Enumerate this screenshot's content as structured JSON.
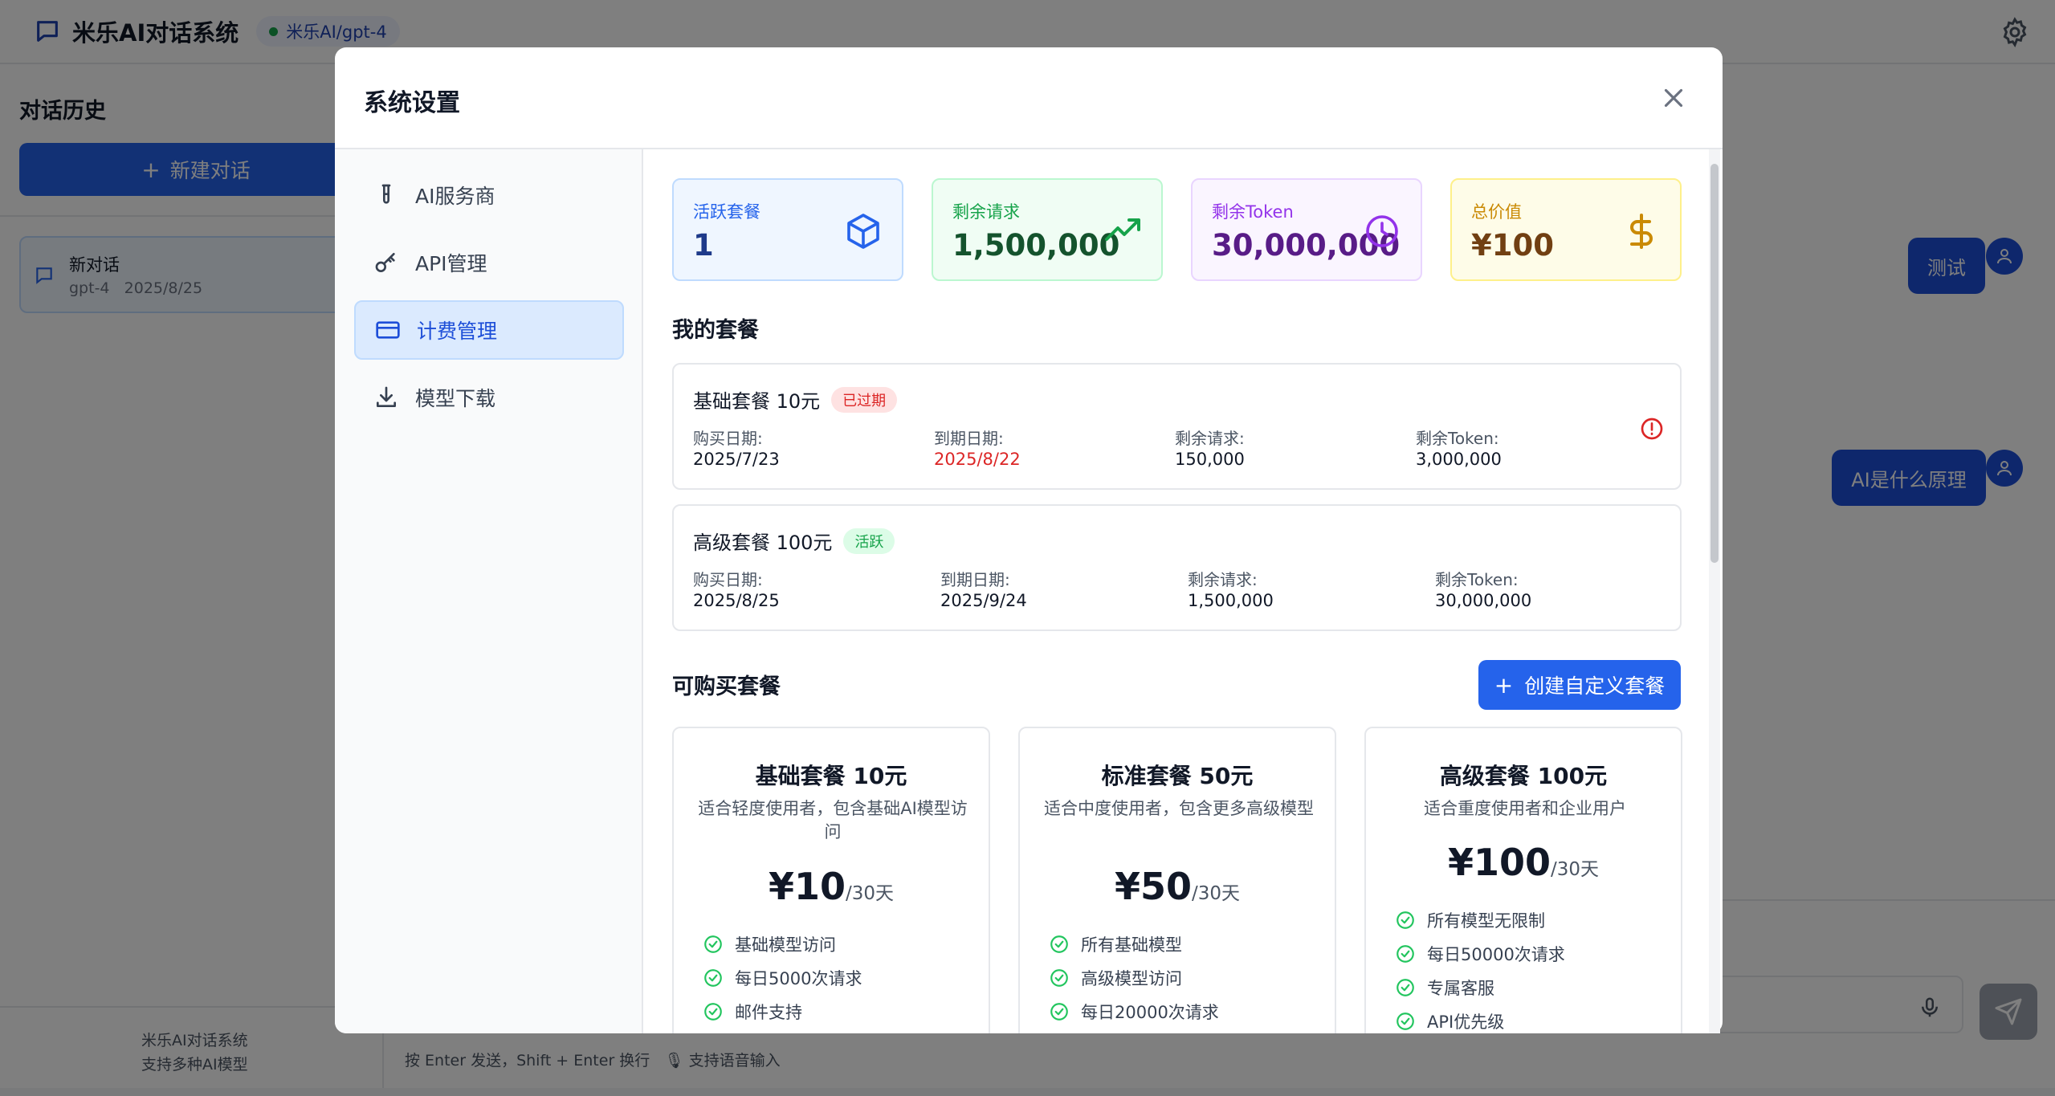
{
  "header": {
    "title": "米乐AI对话系统",
    "model": "米乐AI/gpt-4"
  },
  "sidebar": {
    "history_title": "对话历史",
    "new_chat_label": "新建对话",
    "conversations": [
      {
        "title": "新对话",
        "model": "gpt-4",
        "date": "2025/8/25"
      }
    ],
    "footer_line1": "米乐AI对话系统",
    "footer_line2": "支持多种AI模型"
  },
  "chat": {
    "messages": [
      {
        "text": "测试"
      },
      {
        "text": "AI是什么原理"
      }
    ],
    "hint": "按 Enter 发送，Shift + Enter 换行",
    "voice_hint": "支持语音输入"
  },
  "modal": {
    "title": "系统设置",
    "nav": [
      {
        "label": "AI服务商",
        "icon": "test-tube-icon"
      },
      {
        "label": "API管理",
        "icon": "key-icon"
      },
      {
        "label": "计费管理",
        "icon": "credit-card-icon",
        "active": true
      },
      {
        "label": "模型下载",
        "icon": "download-icon"
      }
    ],
    "stats": [
      {
        "label": "活跃套餐",
        "value": "1",
        "icon": "package-icon",
        "color": "#2563eb"
      },
      {
        "label": "剩余请求",
        "value": "1,500,000",
        "icon": "trending-up-icon",
        "color": "#16a34a"
      },
      {
        "label": "剩余Token",
        "value": "30,000,000",
        "icon": "clock-icon",
        "color": "#9333ea"
      },
      {
        "label": "总价值",
        "value": "¥100",
        "icon": "dollar-icon",
        "color": "#ca8a04"
      }
    ],
    "my_packages_title": "我的套餐",
    "my_packages": [
      {
        "name": "基础套餐 10元",
        "status": "已过期",
        "purchase_label": "购买日期:",
        "purchase_date": "2025/7/23",
        "expire_label": "到期日期:",
        "expire_date": "2025/8/22",
        "req_label": "剩余请求:",
        "req_value": "150,000",
        "token_label": "剩余Token:",
        "token_value": "3,000,000"
      },
      {
        "name": "高级套餐 100元",
        "status": "活跃",
        "purchase_label": "购买日期:",
        "purchase_date": "2025/8/25",
        "expire_label": "到期日期:",
        "expire_date": "2025/9/24",
        "req_label": "剩余请求:",
        "req_value": "1,500,000",
        "token_label": "剩余Token:",
        "token_value": "30,000,000"
      }
    ],
    "available_title": "可购买套餐",
    "create_label": "创建自定义套餐",
    "plans": [
      {
        "name": "基础套餐 10元",
        "desc": "适合轻度使用者，包含基础AI模型访问",
        "price": "¥10",
        "period": "/30天",
        "features": [
          "基础模型访问",
          "每日5000次请求",
          "邮件支持"
        ]
      },
      {
        "name": "标准套餐 50元",
        "desc": "适合中度使用者，包含更多高级模型",
        "price": "¥50",
        "period": "/30天",
        "features": [
          "所有基础模型",
          "高级模型访问",
          "每日20000次请求"
        ]
      },
      {
        "name": "高级套餐 100元",
        "desc": "适合重度使用者和企业用户",
        "price": "¥100",
        "period": "/30天",
        "features": [
          "所有模型无限制",
          "每日50000次请求",
          "专属客服",
          "API优先级"
        ]
      }
    ]
  }
}
